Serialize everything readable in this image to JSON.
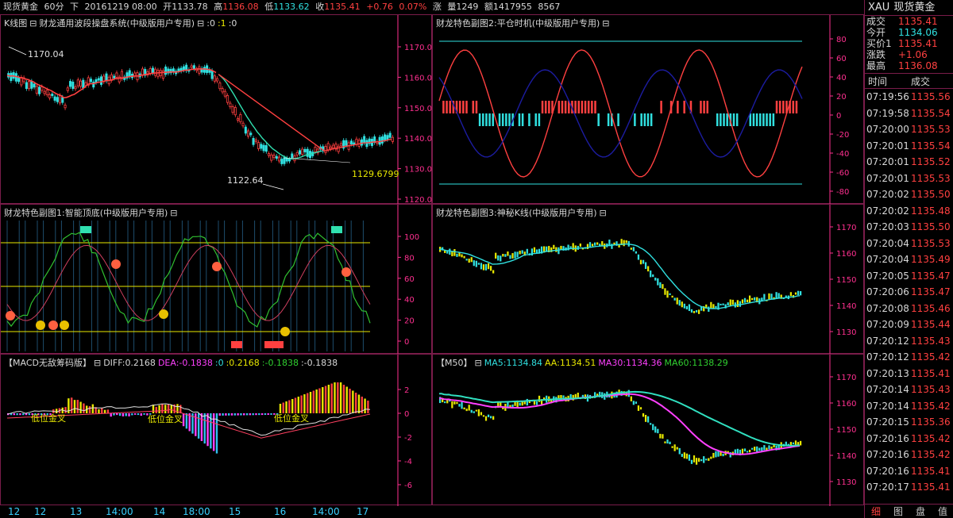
{
  "header": {
    "name": "现货黄金",
    "period": "60分",
    "dir": "下",
    "datetime": "20161219 08:00",
    "open_label": "开",
    "open": "1133.78",
    "high_label": "高",
    "high": "1136.08",
    "low_label": "低",
    "low": "1133.62",
    "close_label": "收",
    "close": "1135.41",
    "change": "+0.76",
    "change_pct": "0.07%",
    "change_label": "涨",
    "vol_label": "量",
    "vol": "1249",
    "amount_label": "额",
    "amount": "1417955",
    "oi": "8567"
  },
  "panels": {
    "kline": {
      "title": "K线图",
      "sub": "财龙通用波段操盘系统(中级版用户专用)",
      "p1": ":0",
      "p2": ":1",
      "p3": ":0",
      "ann_high": "1170.04",
      "ann_low": "1122.64",
      "ann_last": "1129.6799",
      "ticks": [
        "1170.0",
        "1160.0",
        "1150.0",
        "1140.0",
        "1130.0",
        "1120.0"
      ]
    },
    "fig1": {
      "title": "财龙特色副图1:智能顶底(中级版用户专用)",
      "ticks": [
        "100",
        "80",
        "60",
        "40",
        "20",
        "0"
      ]
    },
    "macd": {
      "title": "【MACD无敌筹码版】",
      "diff_label": "DIFF:",
      "diff": "0.2168",
      "dea_label": "DEA:",
      "dea": "-0.1838",
      "v1": ":0",
      "v2": ":0.2168",
      "v3": ":-0.1838",
      "v4": ":-0.1838",
      "ann1": "低位金叉",
      "ann2": "低位金叉",
      "ann3": "低位金叉",
      "ticks": [
        "2",
        "0",
        "-2",
        "-4",
        "-6"
      ]
    },
    "fig2": {
      "title": "财龙特色副图2:平仓时机(中级版用户专用)",
      "ticks": [
        "80",
        "60",
        "40",
        "20",
        "0",
        "-20",
        "-40",
        "-60",
        "-80"
      ]
    },
    "fig3": {
      "title": "财龙特色副图3:神秘K线(中级版用户专用)",
      "ticks": [
        "1170",
        "1160",
        "1150",
        "1140",
        "1130"
      ]
    },
    "ma": {
      "title": "【M50】",
      "ma5_label": "MA5:",
      "ma5": "1134.84",
      "aa_label": "AA:",
      "aa": "1134.51",
      "ma30_label": "MA30:",
      "ma30": "1134.36",
      "ma60_label": "MA60:",
      "ma60": "1138.29",
      "ticks": [
        "1170",
        "1160",
        "1150",
        "1140",
        "1130"
      ]
    }
  },
  "time_axis": [
    "12",
    "12",
    "13",
    "14:00",
    "14",
    "18:00",
    "15",
    "16",
    "14:00",
    "17"
  ],
  "quote": {
    "code": "XAU",
    "name": "现货黄金",
    "rows": [
      {
        "label": "成交",
        "value": "1135.41",
        "color": "#ff4040"
      },
      {
        "label": "今开",
        "value": "1134.06",
        "color": "#30e0e0"
      },
      {
        "label": "买价1",
        "value": "1135.41",
        "color": "#ff4040"
      },
      {
        "label": "涨跌",
        "value": "+1.06",
        "color": "#ff4040"
      },
      {
        "label": "最高",
        "value": "1136.08",
        "color": "#ff4040"
      }
    ]
  },
  "ticks_header": {
    "time": "时间",
    "price": "成交"
  },
  "ticks": [
    {
      "t": "07:19:56",
      "p": "1135.56"
    },
    {
      "t": "07:19:58",
      "p": "1135.54"
    },
    {
      "t": "07:20:00",
      "p": "1135.53"
    },
    {
      "t": "07:20:01",
      "p": "1135.54"
    },
    {
      "t": "07:20:01",
      "p": "1135.52"
    },
    {
      "t": "07:20:01",
      "p": "1135.53"
    },
    {
      "t": "07:20:02",
      "p": "1135.50"
    },
    {
      "t": "07:20:02",
      "p": "1135.48"
    },
    {
      "t": "07:20:03",
      "p": "1135.50"
    },
    {
      "t": "07:20:04",
      "p": "1135.53"
    },
    {
      "t": "07:20:04",
      "p": "1135.49"
    },
    {
      "t": "07:20:05",
      "p": "1135.47"
    },
    {
      "t": "07:20:06",
      "p": "1135.47"
    },
    {
      "t": "07:20:08",
      "p": "1135.46"
    },
    {
      "t": "07:20:09",
      "p": "1135.44"
    },
    {
      "t": "07:20:12",
      "p": "1135.43"
    },
    {
      "t": "07:20:12",
      "p": "1135.42"
    },
    {
      "t": "07:20:13",
      "p": "1135.41"
    },
    {
      "t": "07:20:14",
      "p": "1135.43"
    },
    {
      "t": "07:20:14",
      "p": "1135.42"
    },
    {
      "t": "07:20:15",
      "p": "1135.36"
    },
    {
      "t": "07:20:16",
      "p": "1135.42"
    },
    {
      "t": "07:20:16",
      "p": "1135.42"
    },
    {
      "t": "07:20:16",
      "p": "1135.41"
    },
    {
      "t": "07:20:17",
      "p": "1135.41"
    }
  ],
  "tabs": [
    "细",
    "图",
    "盘",
    "值"
  ],
  "colors": {
    "up": "#ff4040",
    "down": "#30e0e0",
    "border": "#7a1c4a",
    "axis": "#ff3090"
  }
}
